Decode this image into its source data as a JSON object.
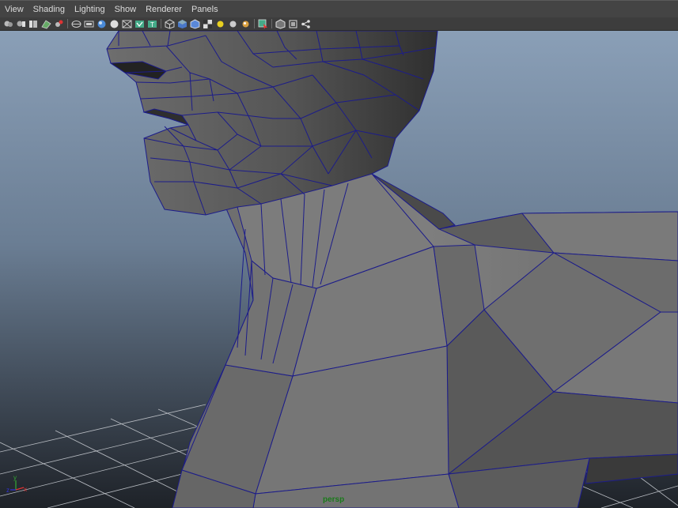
{
  "menubar": {
    "items": [
      {
        "label": "View"
      },
      {
        "label": "Shading"
      },
      {
        "label": "Lighting"
      },
      {
        "label": "Show"
      },
      {
        "label": "Renderer"
      },
      {
        "label": "Panels"
      }
    ]
  },
  "toolbar": {
    "icons": [
      "select-camera-icon",
      "camera-attributes-icon",
      "bookmarks-icon",
      "image-plane-icon",
      "camera-lock-icon",
      "grid-icon",
      "film-gate-icon",
      "resolution-gate-icon",
      "gate-mask-icon",
      "field-chart-icon",
      "safe-action-icon",
      "safe-title-icon",
      "wireframe-icon",
      "smooth-shade-icon",
      "wireframe-on-shaded-icon",
      "textured-icon",
      "default-lighting-icon",
      "all-lights-icon",
      "shadows-icon",
      "isolate-select-icon",
      "xray-icon",
      "xray-joints-icon",
      "backface-icon"
    ]
  },
  "viewport": {
    "camera_label": "persp",
    "axis": {
      "y": "y",
      "x": "x",
      "z": "z"
    }
  },
  "colors": {
    "wire": "#1c1c8a",
    "sky_top": "#8aa0b8",
    "sky_bottom": "#2a2f36",
    "mesh": "#7a7a7a",
    "camera_label": "#1a7a1a"
  }
}
